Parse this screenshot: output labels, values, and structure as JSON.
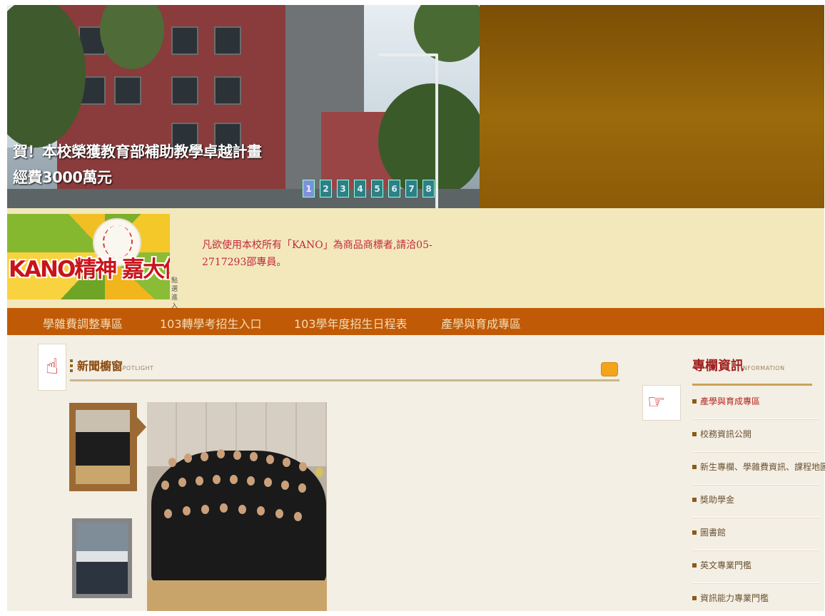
{
  "banner": {
    "caption_line1": "賀！本校榮獲教育部補助教學卓越計畫",
    "caption_line2": "經費3000萬元",
    "pages": [
      "1",
      "2",
      "3",
      "4",
      "5",
      "6",
      "7",
      "8"
    ],
    "active_page": "1"
  },
  "kano": {
    "logo_text": "KANO精神 嘉大傳承",
    "enter_label": "點選進入",
    "notice": "凡欲使用本校所有「KANO」為商品商標者,請洽05-2717293邵專員。"
  },
  "nav": {
    "items": [
      "學雜費調整專區",
      "103轉學考招生入口",
      "103學年度招生日程表",
      "產學與育成專區"
    ]
  },
  "spotlight": {
    "title": "新聞櫥窗",
    "subtitle": "SPOTLIGHT",
    "hand_icon": "pointing-up-hand-icon",
    "more_icon": "more-button-icon"
  },
  "info": {
    "title": "專欄資訊",
    "subtitle": "INFORMATION",
    "items": [
      "產學與育成專區",
      "校務資訊公開",
      "新生專欄、學雜費資訊、課程地圖",
      "獎助學金",
      "圖書館",
      "英文專業門檻",
      "資訊能力專業門檻"
    ]
  },
  "colors": {
    "nav_bg": "#c15a06",
    "banner_side": "#8c5b07",
    "kano_strip": "#f2e8bc",
    "content_bg": "#f4efe4",
    "accent_red": "#c8141a"
  }
}
